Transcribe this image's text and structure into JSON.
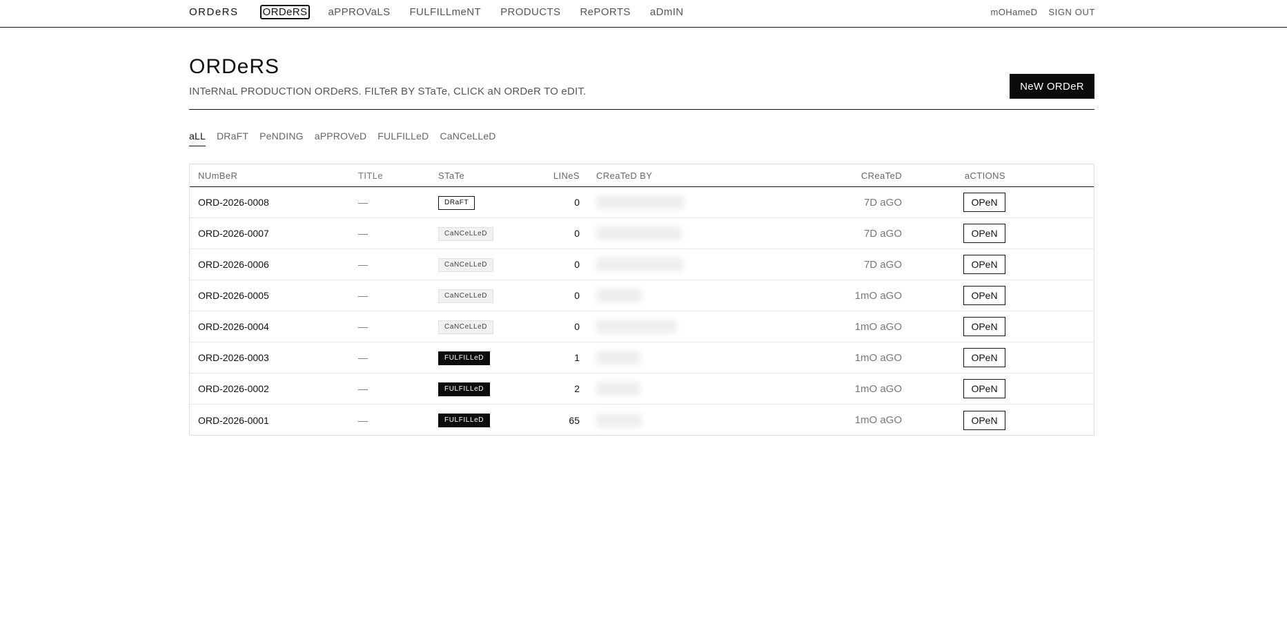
{
  "nav": {
    "brand": "ORDeRS",
    "links": [
      {
        "label": "ORDeRS",
        "active": true
      },
      {
        "label": "aPPROVaLS",
        "active": false
      },
      {
        "label": "FULFILLmeNT",
        "active": false
      },
      {
        "label": "PRODUCTS",
        "active": false
      },
      {
        "label": "RePORTS",
        "active": false
      },
      {
        "label": "aDmIN",
        "active": false
      }
    ],
    "user": "mOHameD",
    "sign_out": "SIGN OUT"
  },
  "header": {
    "title": "ORDeRS",
    "subtitle": "INTeRNaL PRODUCTION ORDeRS. FILTeR BY STaTe, CLICK aN ORDeR TO eDIT.",
    "new_order": "NeW ORDeR"
  },
  "filters": [
    {
      "label": "aLL",
      "active": true
    },
    {
      "label": "DRaFT",
      "active": false
    },
    {
      "label": "PeNDING",
      "active": false
    },
    {
      "label": "aPPROVeD",
      "active": false
    },
    {
      "label": "FULFILLeD",
      "active": false
    },
    {
      "label": "CaNCeLLeD",
      "active": false
    }
  ],
  "table": {
    "columns": {
      "number": "NUmBeR",
      "title": "TITLe",
      "state": "STaTe",
      "lines": "LINeS",
      "created_by": "CReaTeD BY",
      "created": "CReaTeD",
      "actions": "aCTIONS"
    },
    "rows": [
      {
        "number": "ORD-2026-0008",
        "title": "—",
        "state": "DRaFT",
        "state_kind": "draft",
        "lines": "0",
        "created": "7D aGO",
        "action": "OPeN"
      },
      {
        "number": "ORD-2026-0007",
        "title": "—",
        "state": "CaNCeLLeD",
        "state_kind": "cancelled",
        "lines": "0",
        "created": "7D aGO",
        "action": "OPeN"
      },
      {
        "number": "ORD-2026-0006",
        "title": "—",
        "state": "CaNCeLLeD",
        "state_kind": "cancelled",
        "lines": "0",
        "created": "7D aGO",
        "action": "OPeN"
      },
      {
        "number": "ORD-2026-0005",
        "title": "—",
        "state": "CaNCeLLeD",
        "state_kind": "cancelled",
        "lines": "0",
        "created": "1mO aGO",
        "action": "OPeN"
      },
      {
        "number": "ORD-2026-0004",
        "title": "—",
        "state": "CaNCeLLeD",
        "state_kind": "cancelled",
        "lines": "0",
        "created": "1mO aGO",
        "action": "OPeN"
      },
      {
        "number": "ORD-2026-0003",
        "title": "—",
        "state": "FULFILLeD",
        "state_kind": "fulfilled",
        "lines": "1",
        "created": "1mO aGO",
        "action": "OPeN"
      },
      {
        "number": "ORD-2026-0002",
        "title": "—",
        "state": "FULFILLeD",
        "state_kind": "fulfilled",
        "lines": "2",
        "created": "1mO aGO",
        "action": "OPeN"
      },
      {
        "number": "ORD-2026-0001",
        "title": "—",
        "state": "FULFILLeD",
        "state_kind": "fulfilled",
        "lines": "65",
        "created": "1mO aGO",
        "action": "OPeN"
      }
    ]
  }
}
